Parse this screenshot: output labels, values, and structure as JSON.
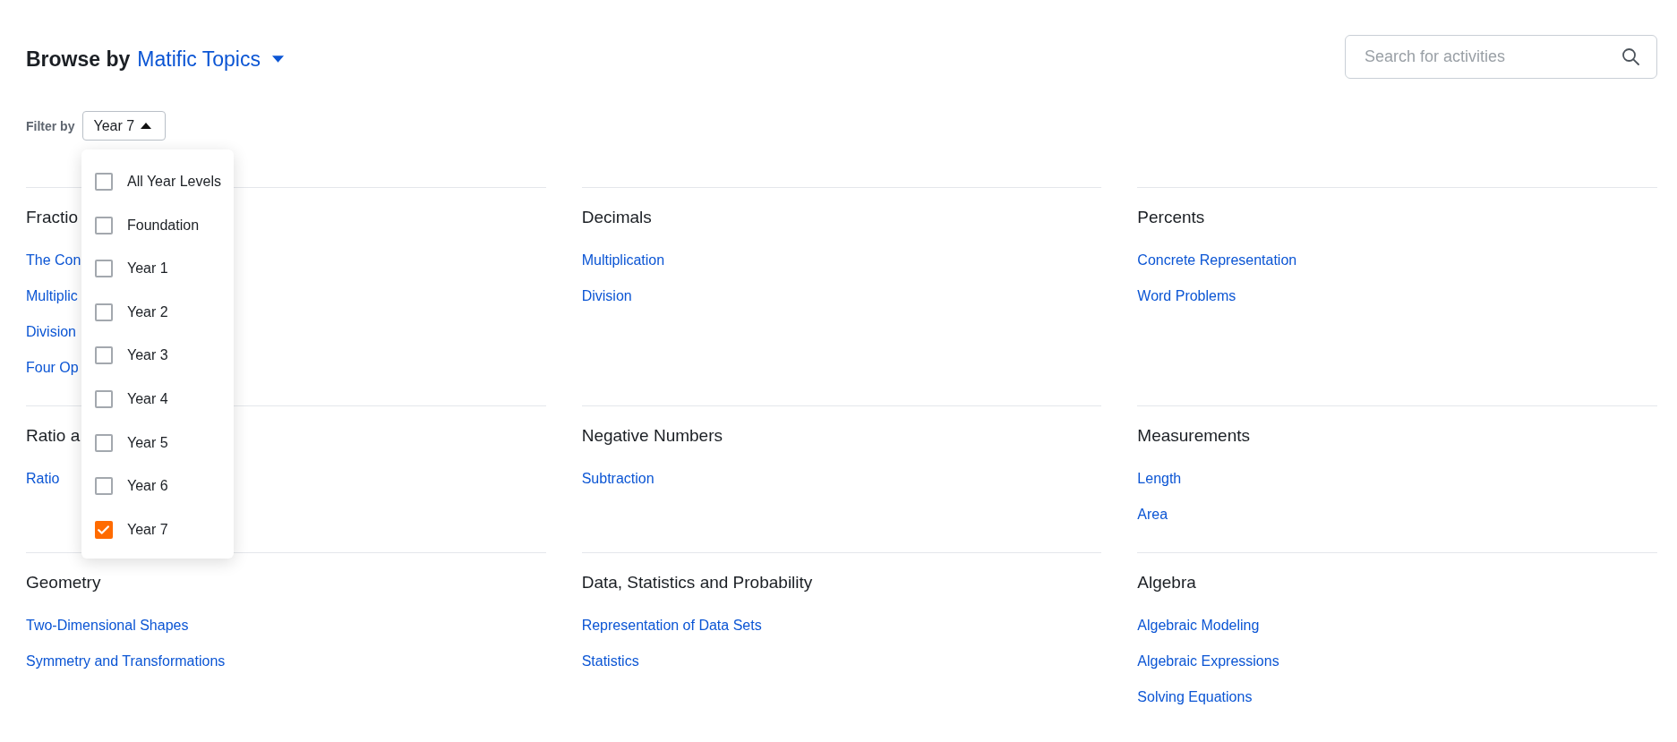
{
  "header": {
    "label": "Browse by",
    "topic_menu": "Matific Topics"
  },
  "search": {
    "placeholder": "Search for activities"
  },
  "filter": {
    "label": "Filter by",
    "value": "Year 7",
    "expanded": true,
    "options": [
      {
        "label": "All Year Levels",
        "checked": false
      },
      {
        "label": "Foundation",
        "checked": false
      },
      {
        "label": "Year 1",
        "checked": false
      },
      {
        "label": "Year 2",
        "checked": false
      },
      {
        "label": "Year 3",
        "checked": false
      },
      {
        "label": "Year 4",
        "checked": false
      },
      {
        "label": "Year 5",
        "checked": false
      },
      {
        "label": "Year 6",
        "checked": false
      },
      {
        "label": "Year 7",
        "checked": true
      }
    ]
  },
  "topics": [
    {
      "title": "Fractio",
      "links": [
        "The Con",
        "Multiplic",
        "Division",
        "Four Op"
      ]
    },
    {
      "title": "Decimals",
      "links": [
        "Multiplication",
        "Division"
      ]
    },
    {
      "title": "Percents",
      "links": [
        "Concrete Representation",
        "Word Problems"
      ]
    },
    {
      "title": "Ratio a",
      "links": [
        "Ratio"
      ]
    },
    {
      "title": "Negative Numbers",
      "links": [
        "Subtraction"
      ]
    },
    {
      "title": "Measurements",
      "links": [
        "Length",
        "Area"
      ]
    },
    {
      "title": "Geometry",
      "links": [
        "Two-Dimensional Shapes",
        "Symmetry and Transformations"
      ]
    },
    {
      "title": "Data, Statistics and Probability",
      "links": [
        "Representation of Data Sets",
        "Statistics"
      ]
    },
    {
      "title": "Algebra",
      "links": [
        "Algebraic Modeling",
        "Algebraic Expressions",
        "Solving Equations"
      ]
    }
  ]
}
